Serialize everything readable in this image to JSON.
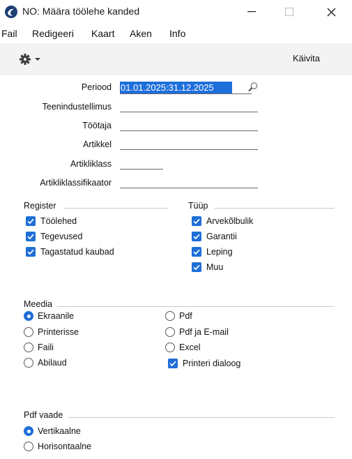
{
  "window": {
    "title": "NO: Määra töölehe kanded",
    "minimize_glyph": "—",
    "maximize_glyph": "☐",
    "close_glyph": "✕"
  },
  "menu": [
    "Fail",
    "Redigeeri",
    "Kaart",
    "Aken",
    "Info"
  ],
  "toolbar": {
    "run_label": "Käivita",
    "settings_icon": "gear-icon"
  },
  "form": {
    "period_label": "Periood",
    "period_value": "01.01.2025:31.12.2025",
    "service_order_label": "Teenindustellimus",
    "worker_label": "Töötaja",
    "item_label": "Artikkel",
    "item_class_label": "Artikliklass",
    "item_classification_label": "Artikliklassifikaator"
  },
  "register": {
    "title": "Register",
    "items": [
      {
        "label": "Töölehed",
        "checked": true
      },
      {
        "label": "Tegevused",
        "checked": true
      },
      {
        "label": "Tagastatud kaubad",
        "checked": true
      }
    ]
  },
  "type": {
    "title": "Tüüp",
    "items": [
      {
        "label": "Arvekõlbulik",
        "checked": true
      },
      {
        "label": "Garantii",
        "checked": true
      },
      {
        "label": "Leping",
        "checked": true
      },
      {
        "label": "Muu",
        "checked": true
      }
    ]
  },
  "media": {
    "title": "Meedia",
    "left": [
      {
        "label": "Ekraanile",
        "selected": true
      },
      {
        "label": "Printerisse",
        "selected": false
      },
      {
        "label": "Faili",
        "selected": false
      },
      {
        "label": "Abilaud",
        "selected": false
      }
    ],
    "right": [
      {
        "label": "Pdf",
        "selected": false
      },
      {
        "label": "Pdf ja E-mail",
        "selected": false
      },
      {
        "label": "Excel",
        "selected": false
      }
    ],
    "printer_dialog": {
      "label": "Printeri dialoog",
      "checked": true
    }
  },
  "pdf_view": {
    "title": "Pdf vaade",
    "items": [
      {
        "label": "Vertikaalne",
        "selected": true
      },
      {
        "label": "Horisontaalne",
        "selected": false
      }
    ]
  },
  "colors": {
    "accent": "#1f6fd6",
    "selection": "#1e6fdb",
    "toolbar_bg": "#f3f3f3"
  }
}
